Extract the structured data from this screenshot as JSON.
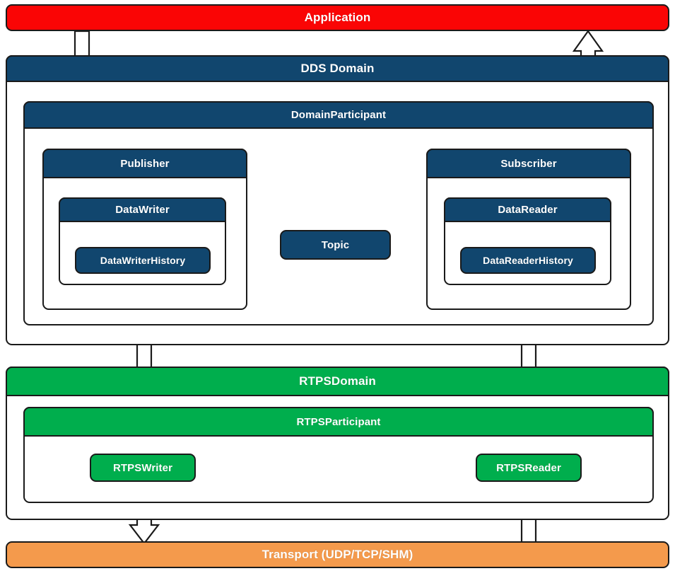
{
  "diagram": {
    "title": "DDS and RTPS layered architecture",
    "colors": {
      "application": "#FA0505",
      "dds": "#11466E",
      "rtps": "#00AE4D",
      "transport": "#F49A4C",
      "outline": "#1A1A1A",
      "background": "#FFFFFF",
      "text": "#FFFFFF"
    }
  },
  "layers": {
    "application": {
      "label": "Application"
    },
    "dds_domain": {
      "label": "DDS Domain"
    },
    "domain_participant": {
      "label": "DomainParticipant"
    },
    "publisher": {
      "label": "Publisher"
    },
    "subscriber": {
      "label": "Subscriber"
    },
    "datawriter": {
      "label": "DataWriter"
    },
    "datareader": {
      "label": "DataReader"
    },
    "datawriter_history": {
      "label": "DataWriterHistory"
    },
    "datareader_history": {
      "label": "DataReaderHistory"
    },
    "topic": {
      "label": "Topic"
    },
    "rtps_domain": {
      "label": "RTPSDomain"
    },
    "rtps_participant": {
      "label": "RTPSParticipant"
    },
    "rtps_writer": {
      "label": "RTPSWriter"
    },
    "rtps_reader": {
      "label": "RTPSReader"
    },
    "transport": {
      "label": "Transport (UDP/TCP/SHM)"
    }
  },
  "connections": [
    {
      "id": "app-to-datawriter",
      "from": "Application",
      "to": "DataWriter",
      "style": "hollow-arrow",
      "direction": "down"
    },
    {
      "id": "datareader-to-app",
      "from": "DataReader",
      "to": "Application",
      "style": "hollow-arrow",
      "direction": "up"
    },
    {
      "id": "datawriterhistory-to-rtpswriter",
      "from": "DataWriterHistory",
      "to": "RTPSWriter",
      "style": "hollow-arrow",
      "direction": "down"
    },
    {
      "id": "rtpsreader-to-datareaderhistory",
      "from": "RTPSReader",
      "to": "DataReaderHistory",
      "style": "hollow-arrow",
      "direction": "up"
    },
    {
      "id": "rtpswriter-to-transport",
      "from": "RTPSWriter",
      "to": "Transport",
      "style": "hollow-arrow",
      "direction": "down"
    },
    {
      "id": "transport-to-rtpsreader",
      "from": "Transport",
      "to": "RTPSReader",
      "style": "hollow-arrow",
      "direction": "up"
    },
    {
      "id": "datawriter-topic",
      "from": "DataWriter",
      "to": "Topic",
      "style": "composition-diamond",
      "direction": "none"
    },
    {
      "id": "datareader-topic",
      "from": "DataReader",
      "to": "Topic",
      "style": "composition-diamond",
      "direction": "none"
    }
  ]
}
